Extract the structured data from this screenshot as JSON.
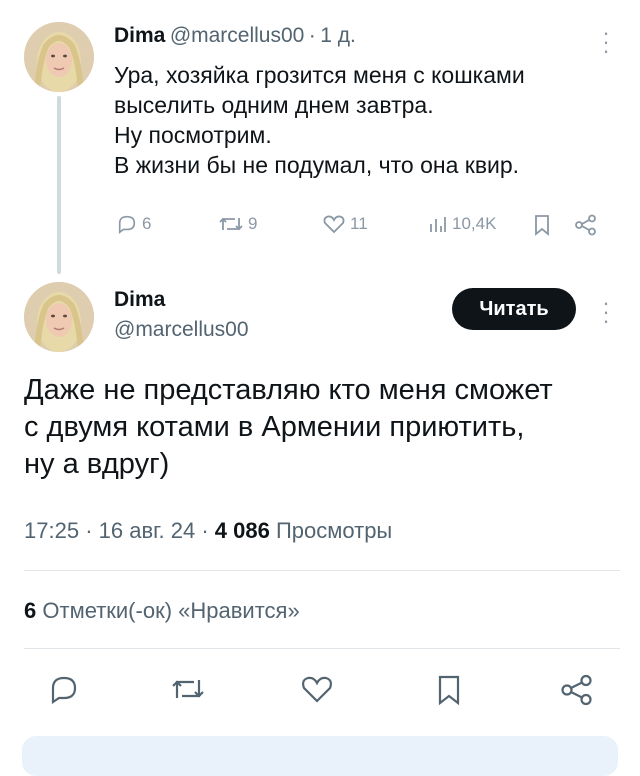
{
  "parent_tweet": {
    "author_name": "Dima",
    "handle": "@marcellus00",
    "separator": "·",
    "time": "1 д.",
    "text": "Ура, хозяйка грозится меня с кошками\nвыселить одним днем завтра.\nНу посмотрим.\nВ жизни бы не подумал, что она квир.",
    "replies": "6",
    "retweets": "9",
    "likes": "11",
    "views": "10,4K"
  },
  "main_tweet": {
    "author_name": "Dima",
    "handle": "@marcellus00",
    "follow_label": "Читать",
    "text": "Даже не представляю кто меня сможет\nс двумя котами в Армении приютить,\nну а вдруг)",
    "time": "17:25",
    "date": "16 авг. 24",
    "sep": "·",
    "views_count": "4 086",
    "views_label": "Просмотры",
    "likes_count": "6",
    "likes_label": "Отметки(-ок) «Нравится»"
  },
  "colors": {
    "text": "#0f1419",
    "muted": "#536471",
    "icon": "#8b98a5",
    "button_bg": "#0f1419",
    "divider": "#dfe5e8"
  },
  "icons": [
    "more-icon",
    "reply-icon",
    "retweet-icon",
    "like-icon",
    "views-icon",
    "bookmark-icon",
    "share-icon"
  ]
}
